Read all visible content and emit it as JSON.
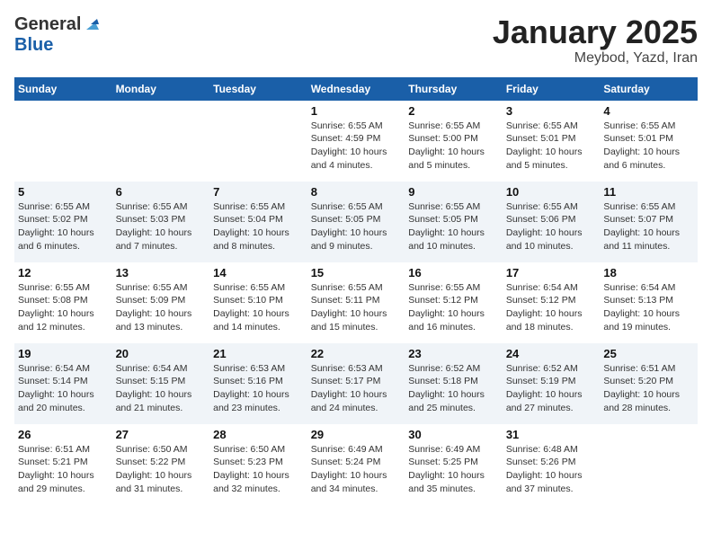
{
  "header": {
    "logo_general": "General",
    "logo_blue": "Blue",
    "title": "January 2025",
    "subtitle": "Meybod, Yazd, Iran"
  },
  "calendar": {
    "days_of_week": [
      "Sunday",
      "Monday",
      "Tuesday",
      "Wednesday",
      "Thursday",
      "Friday",
      "Saturday"
    ],
    "weeks": [
      [
        {
          "day": "",
          "info": ""
        },
        {
          "day": "",
          "info": ""
        },
        {
          "day": "",
          "info": ""
        },
        {
          "day": "1",
          "info": "Sunrise: 6:55 AM\nSunset: 4:59 PM\nDaylight: 10 hours\nand 4 minutes."
        },
        {
          "day": "2",
          "info": "Sunrise: 6:55 AM\nSunset: 5:00 PM\nDaylight: 10 hours\nand 5 minutes."
        },
        {
          "day": "3",
          "info": "Sunrise: 6:55 AM\nSunset: 5:01 PM\nDaylight: 10 hours\nand 5 minutes."
        },
        {
          "day": "4",
          "info": "Sunrise: 6:55 AM\nSunset: 5:01 PM\nDaylight: 10 hours\nand 6 minutes."
        }
      ],
      [
        {
          "day": "5",
          "info": "Sunrise: 6:55 AM\nSunset: 5:02 PM\nDaylight: 10 hours\nand 6 minutes."
        },
        {
          "day": "6",
          "info": "Sunrise: 6:55 AM\nSunset: 5:03 PM\nDaylight: 10 hours\nand 7 minutes."
        },
        {
          "day": "7",
          "info": "Sunrise: 6:55 AM\nSunset: 5:04 PM\nDaylight: 10 hours\nand 8 minutes."
        },
        {
          "day": "8",
          "info": "Sunrise: 6:55 AM\nSunset: 5:05 PM\nDaylight: 10 hours\nand 9 minutes."
        },
        {
          "day": "9",
          "info": "Sunrise: 6:55 AM\nSunset: 5:05 PM\nDaylight: 10 hours\nand 10 minutes."
        },
        {
          "day": "10",
          "info": "Sunrise: 6:55 AM\nSunset: 5:06 PM\nDaylight: 10 hours\nand 10 minutes."
        },
        {
          "day": "11",
          "info": "Sunrise: 6:55 AM\nSunset: 5:07 PM\nDaylight: 10 hours\nand 11 minutes."
        }
      ],
      [
        {
          "day": "12",
          "info": "Sunrise: 6:55 AM\nSunset: 5:08 PM\nDaylight: 10 hours\nand 12 minutes."
        },
        {
          "day": "13",
          "info": "Sunrise: 6:55 AM\nSunset: 5:09 PM\nDaylight: 10 hours\nand 13 minutes."
        },
        {
          "day": "14",
          "info": "Sunrise: 6:55 AM\nSunset: 5:10 PM\nDaylight: 10 hours\nand 14 minutes."
        },
        {
          "day": "15",
          "info": "Sunrise: 6:55 AM\nSunset: 5:11 PM\nDaylight: 10 hours\nand 15 minutes."
        },
        {
          "day": "16",
          "info": "Sunrise: 6:55 AM\nSunset: 5:12 PM\nDaylight: 10 hours\nand 16 minutes."
        },
        {
          "day": "17",
          "info": "Sunrise: 6:54 AM\nSunset: 5:12 PM\nDaylight: 10 hours\nand 18 minutes."
        },
        {
          "day": "18",
          "info": "Sunrise: 6:54 AM\nSunset: 5:13 PM\nDaylight: 10 hours\nand 19 minutes."
        }
      ],
      [
        {
          "day": "19",
          "info": "Sunrise: 6:54 AM\nSunset: 5:14 PM\nDaylight: 10 hours\nand 20 minutes."
        },
        {
          "day": "20",
          "info": "Sunrise: 6:54 AM\nSunset: 5:15 PM\nDaylight: 10 hours\nand 21 minutes."
        },
        {
          "day": "21",
          "info": "Sunrise: 6:53 AM\nSunset: 5:16 PM\nDaylight: 10 hours\nand 23 minutes."
        },
        {
          "day": "22",
          "info": "Sunrise: 6:53 AM\nSunset: 5:17 PM\nDaylight: 10 hours\nand 24 minutes."
        },
        {
          "day": "23",
          "info": "Sunrise: 6:52 AM\nSunset: 5:18 PM\nDaylight: 10 hours\nand 25 minutes."
        },
        {
          "day": "24",
          "info": "Sunrise: 6:52 AM\nSunset: 5:19 PM\nDaylight: 10 hours\nand 27 minutes."
        },
        {
          "day": "25",
          "info": "Sunrise: 6:51 AM\nSunset: 5:20 PM\nDaylight: 10 hours\nand 28 minutes."
        }
      ],
      [
        {
          "day": "26",
          "info": "Sunrise: 6:51 AM\nSunset: 5:21 PM\nDaylight: 10 hours\nand 29 minutes."
        },
        {
          "day": "27",
          "info": "Sunrise: 6:50 AM\nSunset: 5:22 PM\nDaylight: 10 hours\nand 31 minutes."
        },
        {
          "day": "28",
          "info": "Sunrise: 6:50 AM\nSunset: 5:23 PM\nDaylight: 10 hours\nand 32 minutes."
        },
        {
          "day": "29",
          "info": "Sunrise: 6:49 AM\nSunset: 5:24 PM\nDaylight: 10 hours\nand 34 minutes."
        },
        {
          "day": "30",
          "info": "Sunrise: 6:49 AM\nSunset: 5:25 PM\nDaylight: 10 hours\nand 35 minutes."
        },
        {
          "day": "31",
          "info": "Sunrise: 6:48 AM\nSunset: 5:26 PM\nDaylight: 10 hours\nand 37 minutes."
        },
        {
          "day": "",
          "info": ""
        }
      ]
    ]
  }
}
